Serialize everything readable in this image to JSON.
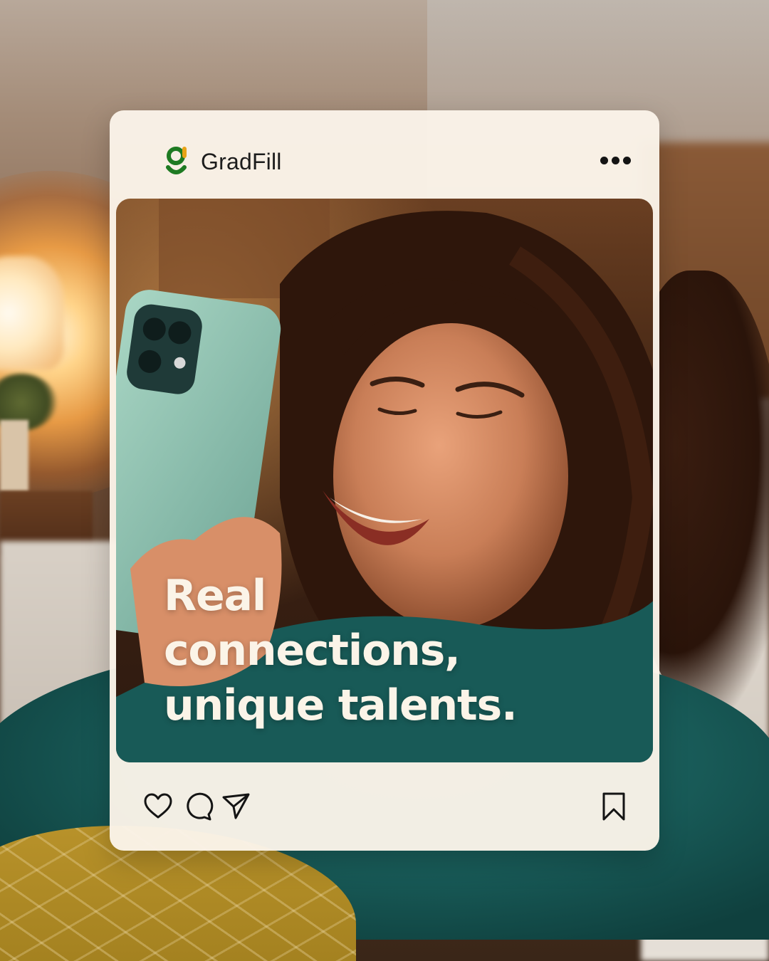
{
  "post": {
    "brand_name": "GradFill",
    "logo_icon": "gradfill-logo-icon",
    "more_icon": "more-options-icon",
    "headline_lines": [
      "Real",
      "connections,",
      "unique talents."
    ],
    "actions": {
      "like_icon": "heart-icon",
      "comment_icon": "comment-icon",
      "share_icon": "send-icon",
      "save_icon": "bookmark-icon"
    }
  },
  "colors": {
    "card_background": "#faf3e8",
    "brand_green": "#1e7a22",
    "brand_accent": "#e8a317",
    "headline_text": "#fbf4e8",
    "icon_color": "#141414"
  }
}
